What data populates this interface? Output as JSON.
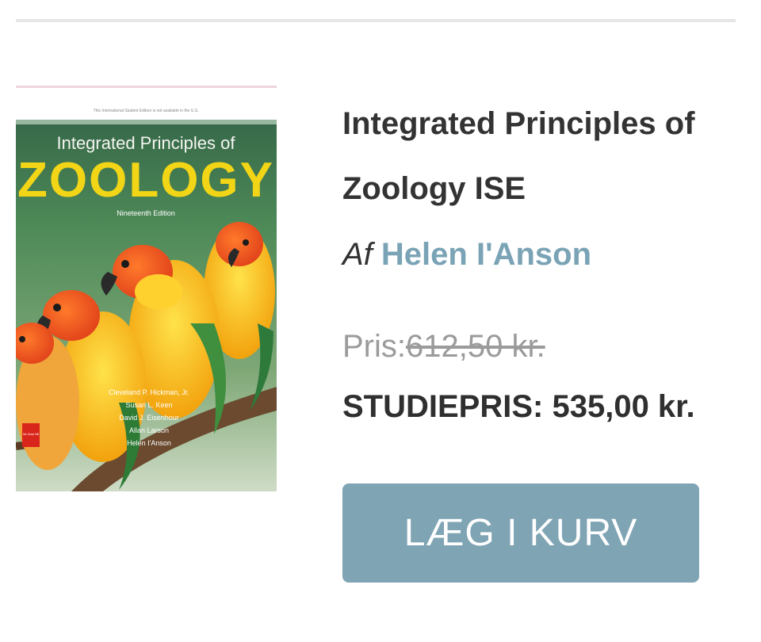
{
  "product": {
    "cover": {
      "series_line": "This International Student Edition is not available in the U.S.",
      "cover_subtitle": "Integrated Principles of",
      "cover_title": "ZOOLOGY",
      "edition": "Nineteenth Edition",
      "authors": [
        "Cleveland P. Hickman, Jr.",
        "Susan L. Keen",
        "David J. Eisenhour",
        "Allan Larson",
        "Helen I'Anson"
      ],
      "publisher": "Mc Graw Hill"
    },
    "title": "Integrated Principles of Zoology ISE",
    "author_prefix": "Af",
    "author_name": "Helen I'Anson",
    "price_label": "Pris:",
    "price_old": "612,50 kr.",
    "student_price": "STUDIEPRIS: 535,00 kr.",
    "add_to_cart_label": "LÆG I KURV"
  },
  "colors": {
    "accent": "#7fa4b4",
    "author_link": "#7aa3b5",
    "text_dark": "#333333",
    "text_muted": "#9b9b9b",
    "divider": "#e6e6e6"
  }
}
